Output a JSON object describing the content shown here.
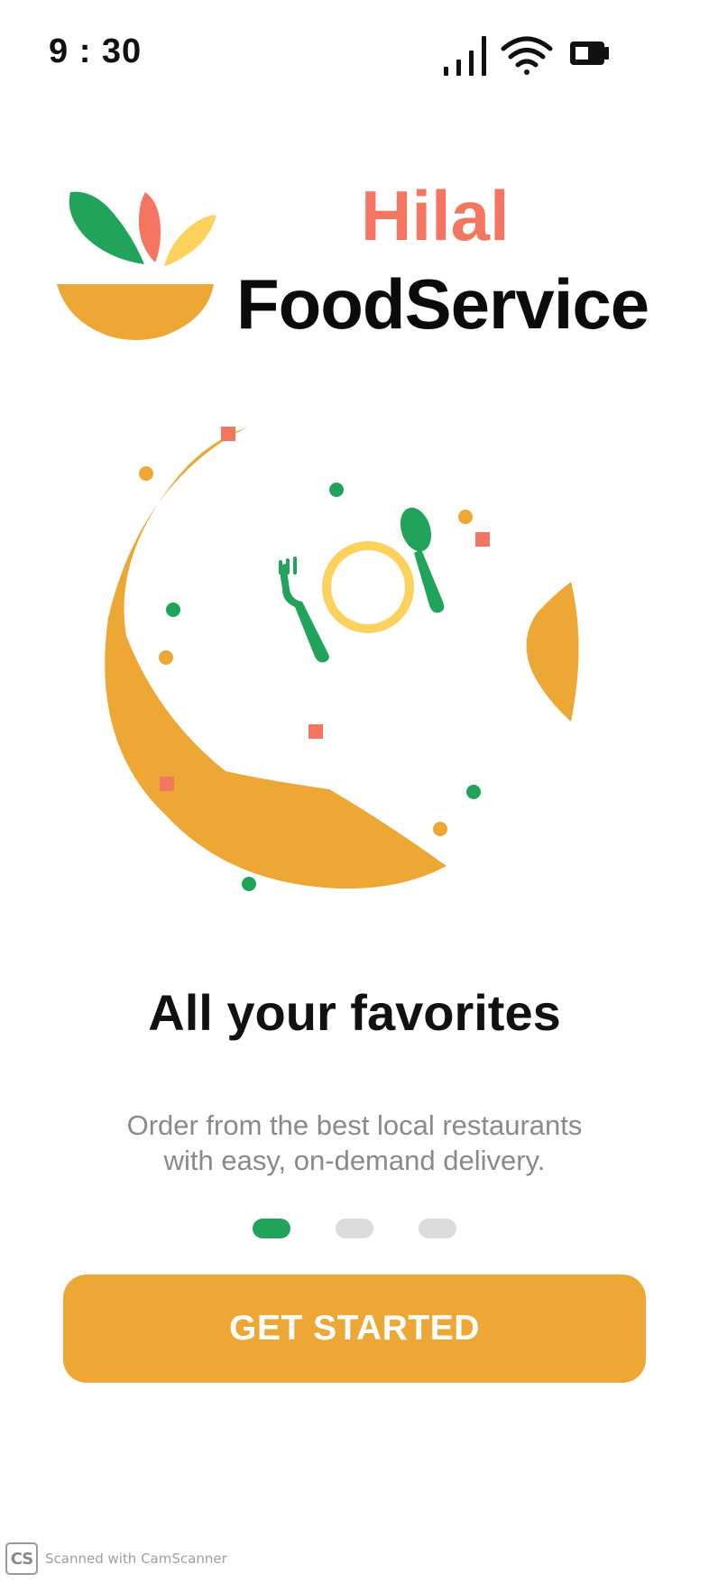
{
  "status_bar": {
    "time": "9 : 30",
    "icons": [
      "signal-icon",
      "wifi-icon",
      "battery-icon"
    ]
  },
  "brand": {
    "line1": "Hilal",
    "line2": "FoodService",
    "colors": {
      "accent_red": "#f47560",
      "green": "#21a35b",
      "yellow": "#fcd15c",
      "orange": "#eda735"
    },
    "icon": "food-bowl-logo-icon"
  },
  "illustration": {
    "icon": "plate-fork-spoon-illustration"
  },
  "onboarding": {
    "title": "All your favorites",
    "subtitle_line1": "Order from the best local restaurants",
    "subtitle_line2": "with easy, on-demand delivery.",
    "pager": {
      "active_index": 0,
      "count": 3,
      "active_color": "#21a35b",
      "inactive_color": "#dcdcdc"
    }
  },
  "actions": {
    "get_started_label": "GET STARTED",
    "button_color": "#eda735"
  },
  "watermark": {
    "logo_text": "CS",
    "text": "Scanned with CamScanner"
  }
}
